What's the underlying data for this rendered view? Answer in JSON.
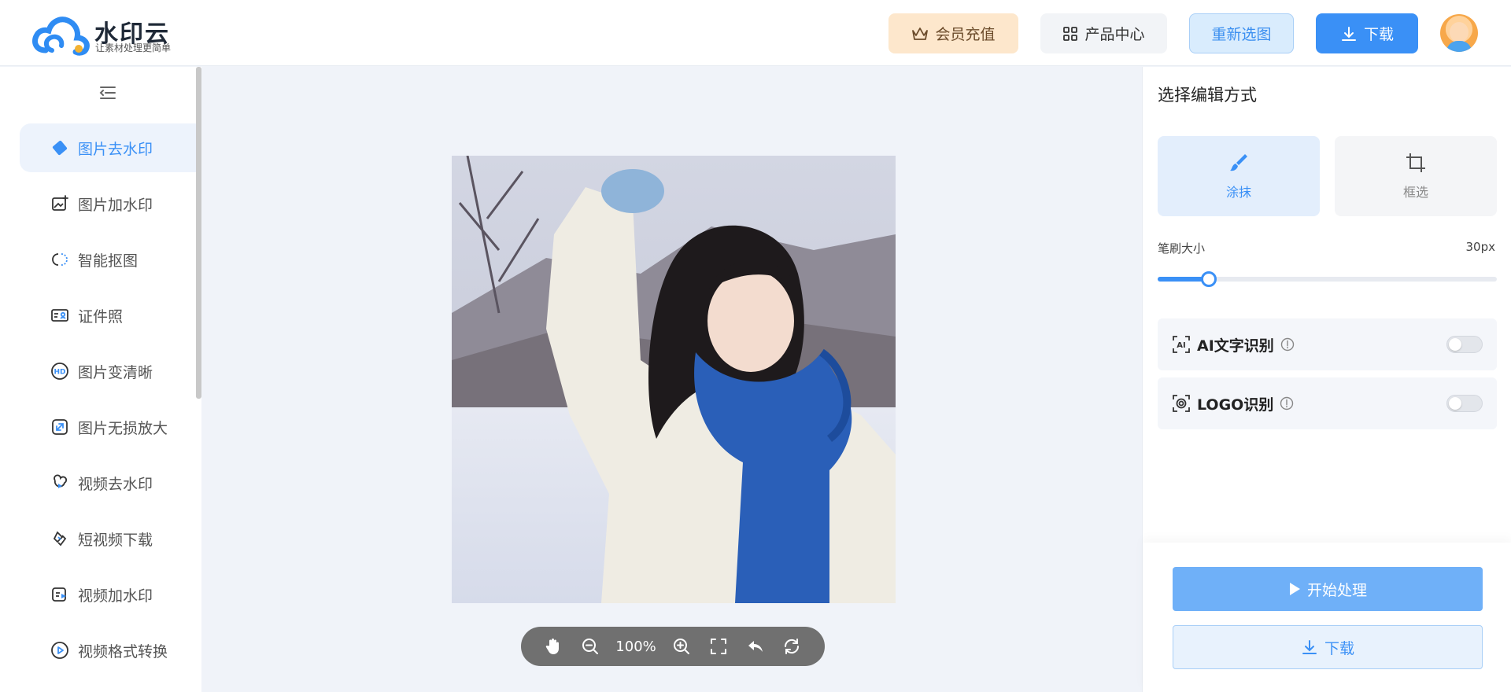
{
  "brand": {
    "name": "水印云",
    "tagline": "让素材处理更简单"
  },
  "header": {
    "vip_label": "会员充值",
    "products_label": "产品中心",
    "reselect_label": "重新选图",
    "download_label": "下载"
  },
  "sidebar": {
    "items": [
      {
        "label": "图片去水印",
        "icon": "eraser-icon",
        "active": true
      },
      {
        "label": "图片加水印",
        "icon": "image-add-icon",
        "active": false
      },
      {
        "label": "智能抠图",
        "icon": "cutout-icon",
        "active": false
      },
      {
        "label": "证件照",
        "icon": "id-card-icon",
        "active": false
      },
      {
        "label": "图片变清晰",
        "icon": "hd-icon",
        "active": false
      },
      {
        "label": "图片无损放大",
        "icon": "enlarge-icon",
        "active": false
      },
      {
        "label": "视频去水印",
        "icon": "video-eraser-icon",
        "active": false
      },
      {
        "label": "短视频下载",
        "icon": "link-icon",
        "active": false
      },
      {
        "label": "视频加水印",
        "icon": "video-add-icon",
        "active": false
      },
      {
        "label": "视频格式转换",
        "icon": "play-circle-icon",
        "active": false
      }
    ]
  },
  "canvas": {
    "zoom": "100%"
  },
  "panel": {
    "title": "选择编辑方式",
    "modes": [
      {
        "label": "涂抹",
        "icon": "brush-icon",
        "active": true
      },
      {
        "label": "框选",
        "icon": "crop-icon",
        "active": false
      }
    ],
    "brush": {
      "label": "笔刷大小",
      "value_text": "30px",
      "fraction": 0.15
    },
    "options": [
      {
        "label": "AI文字识别",
        "icon": "ai-text-icon",
        "enabled": false
      },
      {
        "label": "LOGO识别",
        "icon": "logo-detect-icon",
        "enabled": false
      }
    ],
    "start_label": "开始处理",
    "download_label": "下载"
  },
  "colors": {
    "accent": "#3a90f6",
    "vip_bg": "#fde7cc",
    "sidebar_active_bg": "#edf3fc"
  }
}
